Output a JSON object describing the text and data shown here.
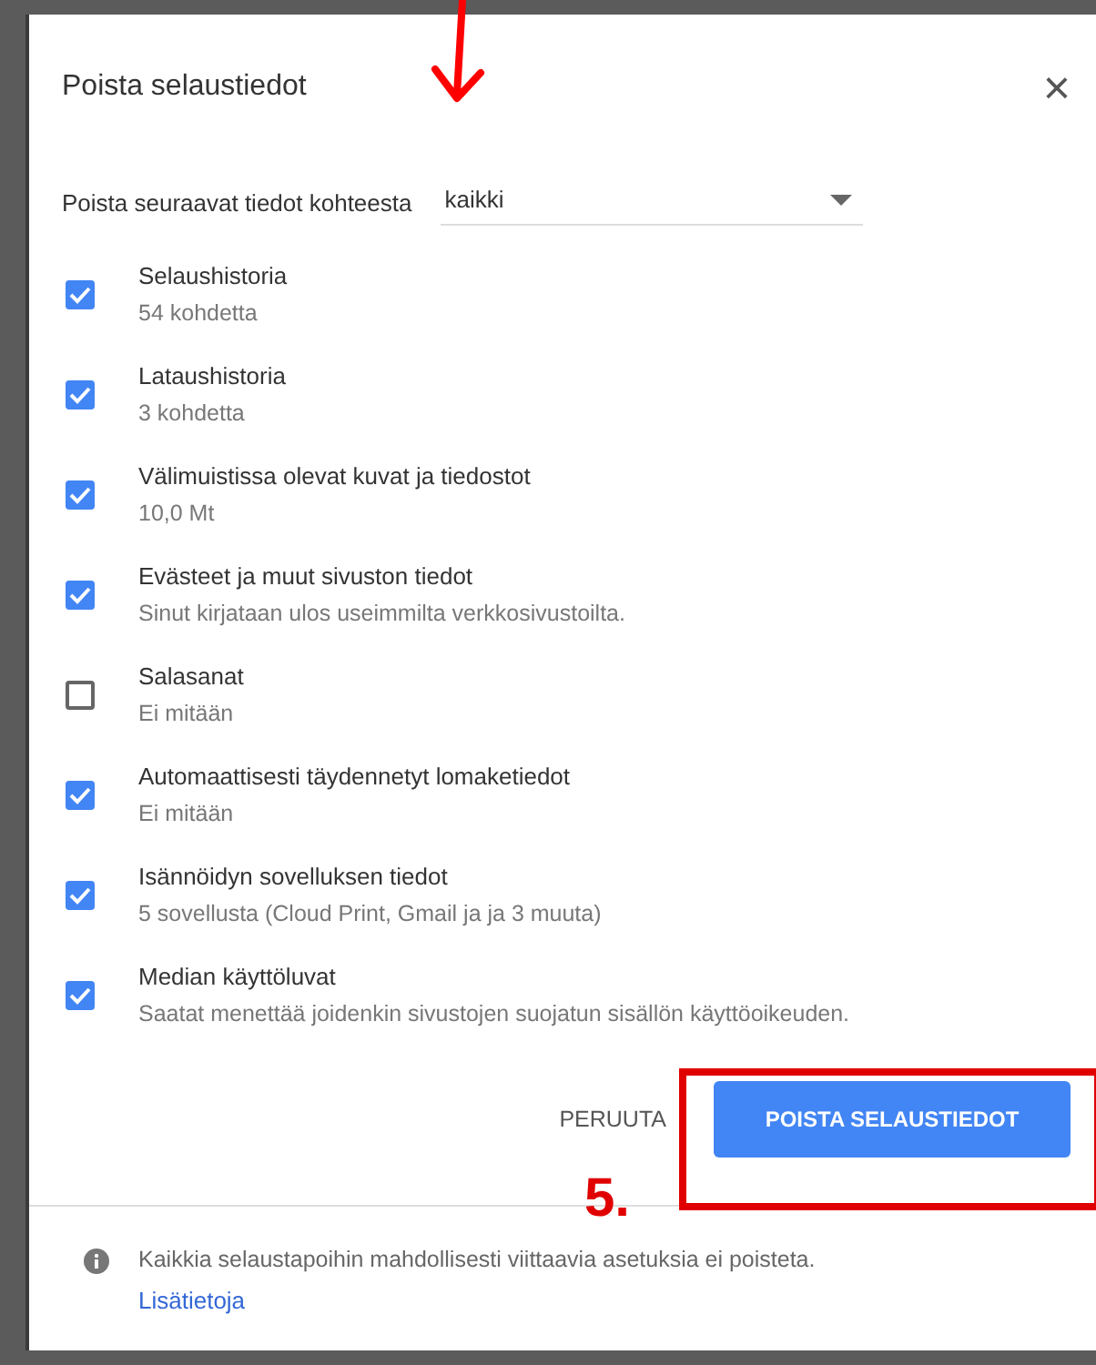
{
  "dialog": {
    "title": "Poista selaustiedot",
    "close": "×"
  },
  "range": {
    "label": "Poista seuraavat tiedot kohteesta",
    "value": "kaikki"
  },
  "items": [
    {
      "title": "Selaushistoria",
      "detail": "54 kohdetta",
      "checked": true
    },
    {
      "title": "Lataushistoria",
      "detail": "3 kohdetta",
      "checked": true
    },
    {
      "title": "Välimuistissa olevat kuvat ja tiedostot",
      "detail": "10,0 Mt",
      "checked": true
    },
    {
      "title": "Evästeet ja muut sivuston tiedot",
      "detail": "Sinut kirjataan ulos useimmilta verkkosivustoilta.",
      "checked": true
    },
    {
      "title": "Salasanat",
      "detail": "Ei mitään",
      "checked": false
    },
    {
      "title": "Automaattisesti täydennetyt lomaketiedot",
      "detail": "Ei mitään",
      "checked": true
    },
    {
      "title": "Isännöidyn sovelluksen tiedot",
      "detail": "5 sovellusta (Cloud Print, Gmail ja ja 3 muuta)",
      "checked": true
    },
    {
      "title": "Median käyttöluvat",
      "detail": "Saatat menettää joidenkin sivustojen suojatun sisällön käyttöoikeuden.",
      "checked": true
    }
  ],
  "buttons": {
    "cancel": "PERUUTA",
    "confirm": "POISTA SELAUSTIEDOT"
  },
  "annotation": {
    "step": "5."
  },
  "footer": {
    "note": "Kaikkia selaustapoihin mahdollisesti viittaavia asetuksia ei poisteta.",
    "link": "Lisätietoja"
  }
}
